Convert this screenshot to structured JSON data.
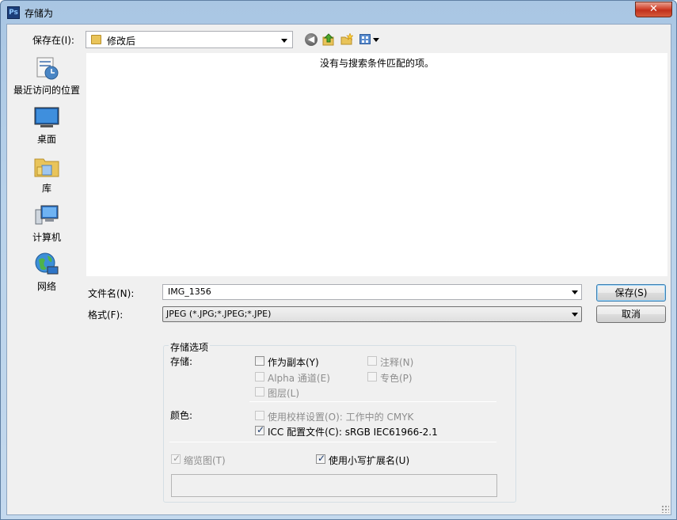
{
  "window": {
    "title": "存储为",
    "app_icon": "Ps"
  },
  "toolbar": {
    "save_in_label": "保存在(I):",
    "location": "修改后"
  },
  "places": [
    {
      "label": "最近访问的位置",
      "icon": "recent-places-icon"
    },
    {
      "label": "桌面",
      "icon": "desktop-icon"
    },
    {
      "label": "库",
      "icon": "libraries-icon"
    },
    {
      "label": "计算机",
      "icon": "computer-icon"
    },
    {
      "label": "网络",
      "icon": "network-icon"
    }
  ],
  "file_list": {
    "empty_message": "没有与搜索条件匹配的项。"
  },
  "form": {
    "filename_label": "文件名(N):",
    "filename_value": "IMG_1356",
    "format_label": "格式(F):",
    "format_value": "JPEG (*.JPG;*.JPEG;*.JPE)",
    "save_label": "保存(S)",
    "cancel_label": "取消"
  },
  "options": {
    "title": "存储选项",
    "save_label": "存储:",
    "as_copy": "作为副本(Y)",
    "notes": "注释(N)",
    "alpha": "Alpha 通道(E)",
    "spot": "专色(P)",
    "layers": "图层(L)",
    "color_label": "颜色:",
    "proof": "使用校样设置(O): 工作中的 CMYK",
    "icc": "ICC 配置文件(C): sRGB IEC61966-2.1",
    "thumbnail": "缩览图(T)",
    "lowercase": "使用小写扩展名(U)"
  },
  "colors": {
    "accent": "#3c7fb1",
    "title_bar": "#b9d2ea",
    "close": "#c0301c"
  }
}
